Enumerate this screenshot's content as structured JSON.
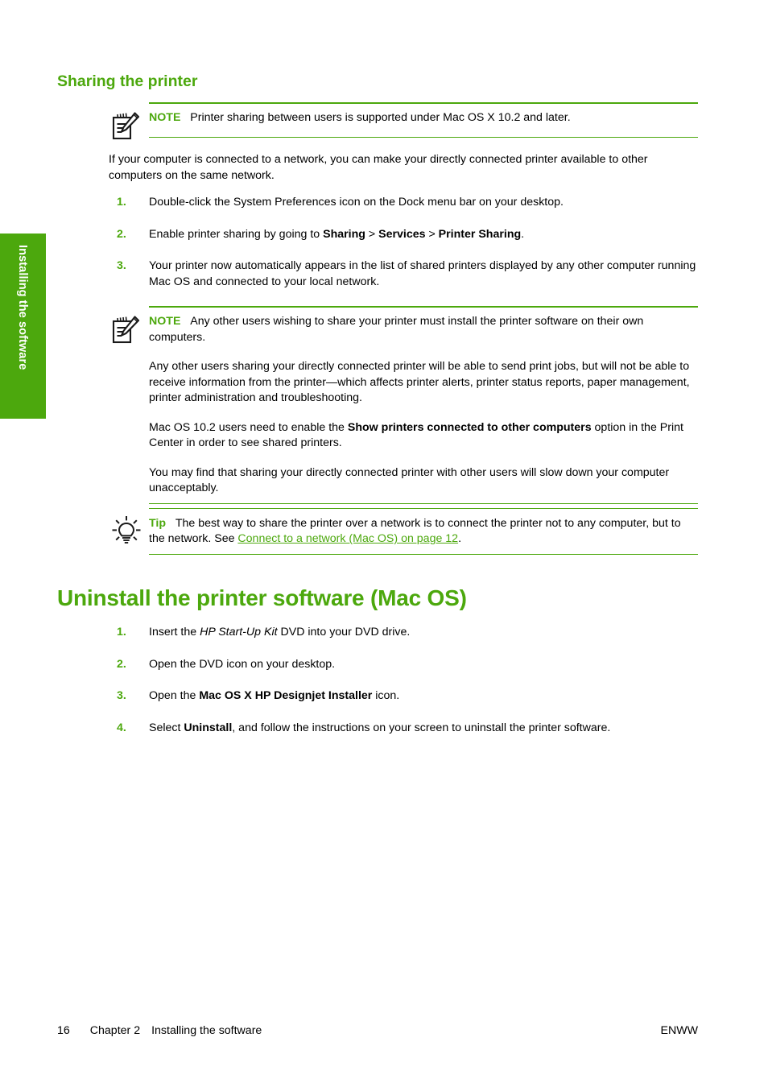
{
  "side_tab": {
    "label": "Installing the software",
    "bg_color": "#4CA80D"
  },
  "accent_color": "#4CA80D",
  "headings": {
    "section": "Sharing the printer",
    "chapter": "Uninstall the printer software (Mac OS)"
  },
  "note1": {
    "icon": "note-pad-pencil-icon",
    "label": "NOTE",
    "text": "Printer sharing between users is supported under Mac OS X 10.2 and later."
  },
  "intro": "If your computer is connected to a network, you can make your directly connected printer available to other computers on the same network.",
  "steps_sharing": [
    {
      "num": "1.",
      "parts": [
        {
          "text": "Double-click the System Preferences icon on the Dock menu bar on your desktop.",
          "style": "normal"
        }
      ]
    },
    {
      "num": "2.",
      "parts": [
        {
          "text": "Enable printer sharing by going to ",
          "style": "normal"
        },
        {
          "text": "Sharing",
          "style": "bold"
        },
        {
          "text": " > ",
          "style": "normal"
        },
        {
          "text": "Services",
          "style": "bold"
        },
        {
          "text": " > ",
          "style": "normal"
        },
        {
          "text": "Printer Sharing",
          "style": "bold"
        },
        {
          "text": ".",
          "style": "normal"
        }
      ]
    },
    {
      "num": "3.",
      "parts": [
        {
          "text": "Your printer now automatically appears in the list of shared printers displayed by any other computer running Mac OS and connected to your local network.",
          "style": "normal"
        }
      ]
    }
  ],
  "note2": {
    "icon": "note-pad-pencil-icon",
    "label": "NOTE",
    "text": "Any other users wishing to share your printer must install the printer software on their own computers.",
    "paragraphs": [
      {
        "parts": [
          {
            "text": "Any other users sharing your directly connected printer will be able to send print jobs, but will not be able to receive information from the printer—which affects printer alerts, printer status reports, paper management, printer administration and troubleshooting.",
            "style": "normal"
          }
        ]
      },
      {
        "parts": [
          {
            "text": "Mac OS 10.2 users need to enable the ",
            "style": "normal"
          },
          {
            "text": "Show printers connected to other computers",
            "style": "bold"
          },
          {
            "text": " option in the Print Center in order to see shared printers.",
            "style": "normal"
          }
        ]
      },
      {
        "parts": [
          {
            "text": "You may find that sharing your directly connected printer with other users will slow down your computer unacceptably.",
            "style": "normal"
          }
        ]
      }
    ]
  },
  "tip": {
    "icon": "lightbulb-icon",
    "label": "Tip",
    "parts": [
      {
        "text": "The best way to share the printer over a network is to connect the printer not to any computer, but to the network. See ",
        "style": "normal"
      },
      {
        "text": "Connect to a network (Mac OS) on page 12",
        "style": "link"
      },
      {
        "text": ".",
        "style": "normal"
      }
    ]
  },
  "steps_uninstall": [
    {
      "num": "1.",
      "parts": [
        {
          "text": "Insert the ",
          "style": "normal"
        },
        {
          "text": "HP Start-Up Kit",
          "style": "italic"
        },
        {
          "text": " DVD into your DVD drive.",
          "style": "normal"
        }
      ]
    },
    {
      "num": "2.",
      "parts": [
        {
          "text": "Open the DVD icon on your desktop.",
          "style": "normal"
        }
      ]
    },
    {
      "num": "3.",
      "parts": [
        {
          "text": "Open the ",
          "style": "normal"
        },
        {
          "text": "Mac OS X HP Designjet Installer",
          "style": "bold"
        },
        {
          "text": " icon.",
          "style": "normal"
        }
      ]
    },
    {
      "num": "4.",
      "parts": [
        {
          "text": "Select ",
          "style": "normal"
        },
        {
          "text": "Uninstall",
          "style": "bold"
        },
        {
          "text": ", and follow the instructions on your screen to uninstall the printer software.",
          "style": "normal"
        }
      ]
    }
  ],
  "footer": {
    "page_number": "16",
    "chapter": "Chapter 2",
    "chapter_title": "Installing the software",
    "right": "ENWW"
  }
}
